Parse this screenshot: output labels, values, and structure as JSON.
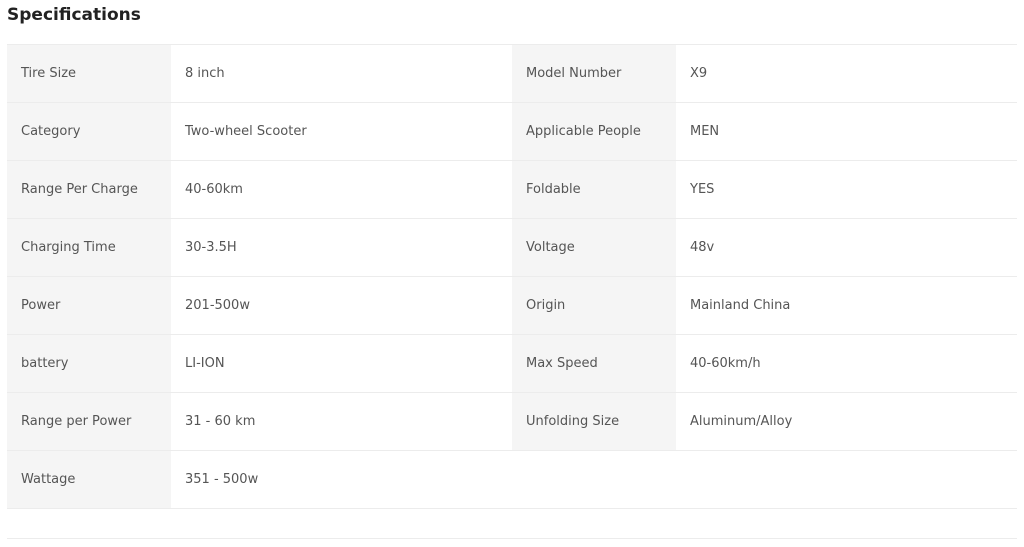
{
  "title": "Specifications",
  "rows": [
    {
      "label1": "Tire Size",
      "value1": "8 inch",
      "label2": "Model Number",
      "value2": "X9"
    },
    {
      "label1": "Category",
      "value1": "Two-wheel Scooter",
      "label2": "Applicable People",
      "value2": "MEN"
    },
    {
      "label1": "Range Per Charge",
      "value1": "40-60km",
      "label2": "Foldable",
      "value2": "YES"
    },
    {
      "label1": "Charging Time",
      "value1": "30-3.5H",
      "label2": "Voltage",
      "value2": "48v"
    },
    {
      "label1": "Power",
      "value1": "201-500w",
      "label2": "Origin",
      "value2": "Mainland China"
    },
    {
      "label1": "battery",
      "value1": "LI-ION",
      "label2": "Max Speed",
      "value2": "40-60km/h"
    },
    {
      "label1": "Range per Power",
      "value1": "31 - 60 km",
      "label2": "Unfolding Size",
      "value2": "Aluminum/Alloy"
    },
    {
      "label1": "Wattage",
      "value1": "351 - 500w"
    }
  ]
}
